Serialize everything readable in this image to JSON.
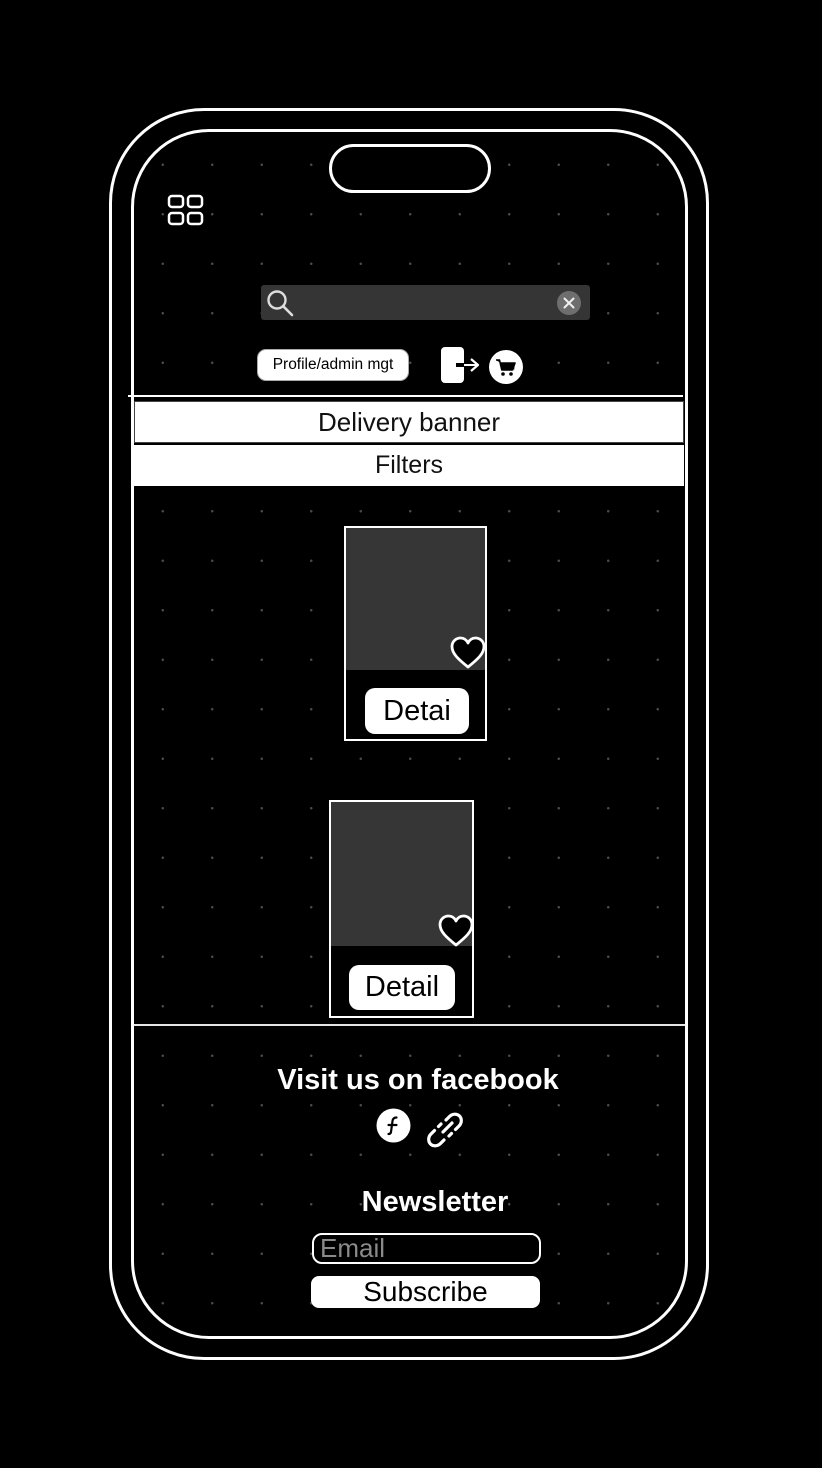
{
  "header": {
    "menu_icon": "grid-icon",
    "search": {
      "placeholder": "",
      "value": ""
    },
    "profile_button_label": "Profile/admin mgt",
    "logout_icon": "logout-icon",
    "cart_icon": "cart-icon"
  },
  "delivery_banner": {
    "label": "Delivery banner"
  },
  "filters": {
    "label": "Filters"
  },
  "products": [
    {
      "detail_label": "Detai",
      "favorite_icon": "heart-icon"
    },
    {
      "detail_label": "Detail",
      "favorite_icon": "heart-icon"
    }
  ],
  "footer": {
    "facebook_heading": "Visit us on facebook",
    "social_icons": [
      "facebook-icon",
      "link-icon"
    ],
    "newsletter_heading": "Newsletter",
    "email_placeholder": "Email",
    "subscribe_label": "Subscribe"
  },
  "colors": {
    "background": "#000000",
    "foreground": "#ffffff",
    "placeholder_gray": "#363636",
    "search_bar": "#353535"
  }
}
